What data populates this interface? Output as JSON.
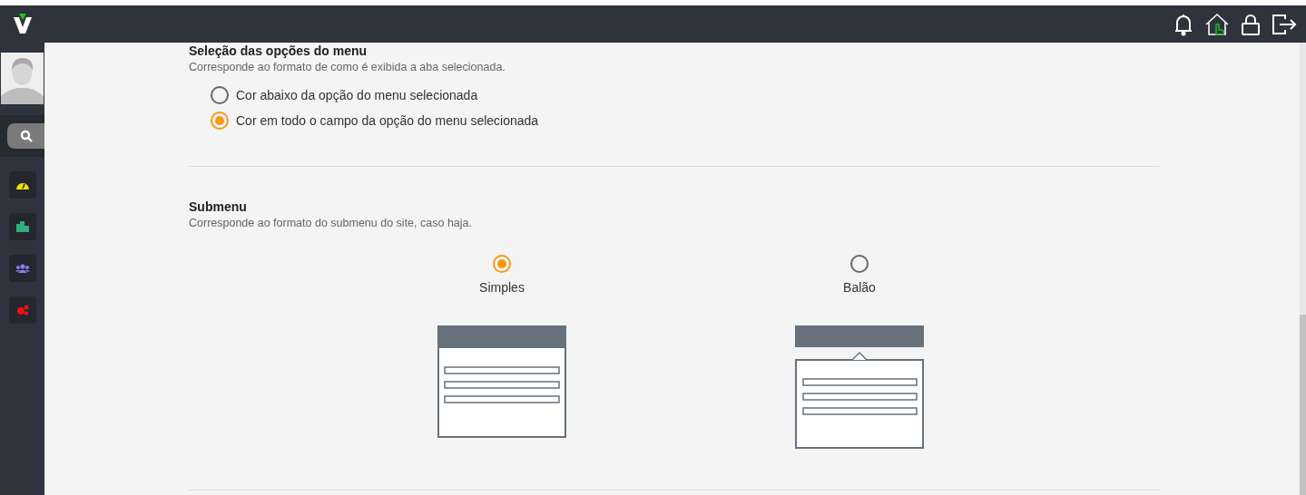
{
  "sections": [
    {
      "title": "Seleção das opções do menu",
      "description": "Corresponde ao formato de como é exibida a aba selecionada.",
      "kind": "list",
      "options": [
        {
          "label": "Cor abaixo da opção do menu selecionada",
          "selected": false
        },
        {
          "label": "Cor em todo o campo da opção do menu selecionada",
          "selected": true
        }
      ]
    },
    {
      "title": "Submenu",
      "description": "Corresponde ao formato do submenu do site, caso haja.",
      "kind": "preview",
      "options": [
        {
          "label": "Simples",
          "selected": true,
          "kind": "simple"
        },
        {
          "label": "Balão",
          "selected": false,
          "kind": "balloon"
        }
      ]
    }
  ]
}
